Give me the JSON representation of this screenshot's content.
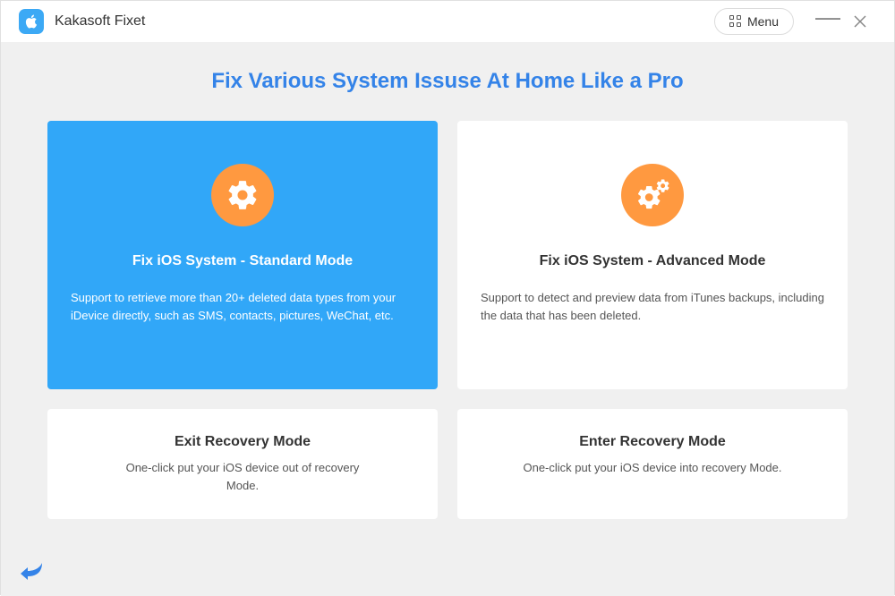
{
  "app": {
    "title": "Kakasoft Fixet"
  },
  "titlebar": {
    "menu_label": "Menu"
  },
  "main": {
    "heading": "Fix Various System Issuse At Home Like a Pro"
  },
  "cards": {
    "standard": {
      "title": "Fix iOS System - Standard Mode",
      "desc": "Support to retrieve more than 20+ deleted data types from your iDevice directly, such as SMS, contacts, pictures, WeChat, etc."
    },
    "advanced": {
      "title": "Fix iOS System - Advanced Mode",
      "desc": "Support to detect and preview data from iTunes backups, including the data that has been deleted."
    },
    "exit": {
      "title": "Exit Recovery Mode",
      "desc": "One-click put your iOS device out of recovery Mode."
    },
    "enter": {
      "title": "Enter Recovery Mode",
      "desc": "One-click put your iOS device into recovery Mode."
    }
  },
  "colors": {
    "accent_blue": "#3483e8",
    "card_active": "#31a7f8",
    "icon_orange": "#ff9940"
  }
}
